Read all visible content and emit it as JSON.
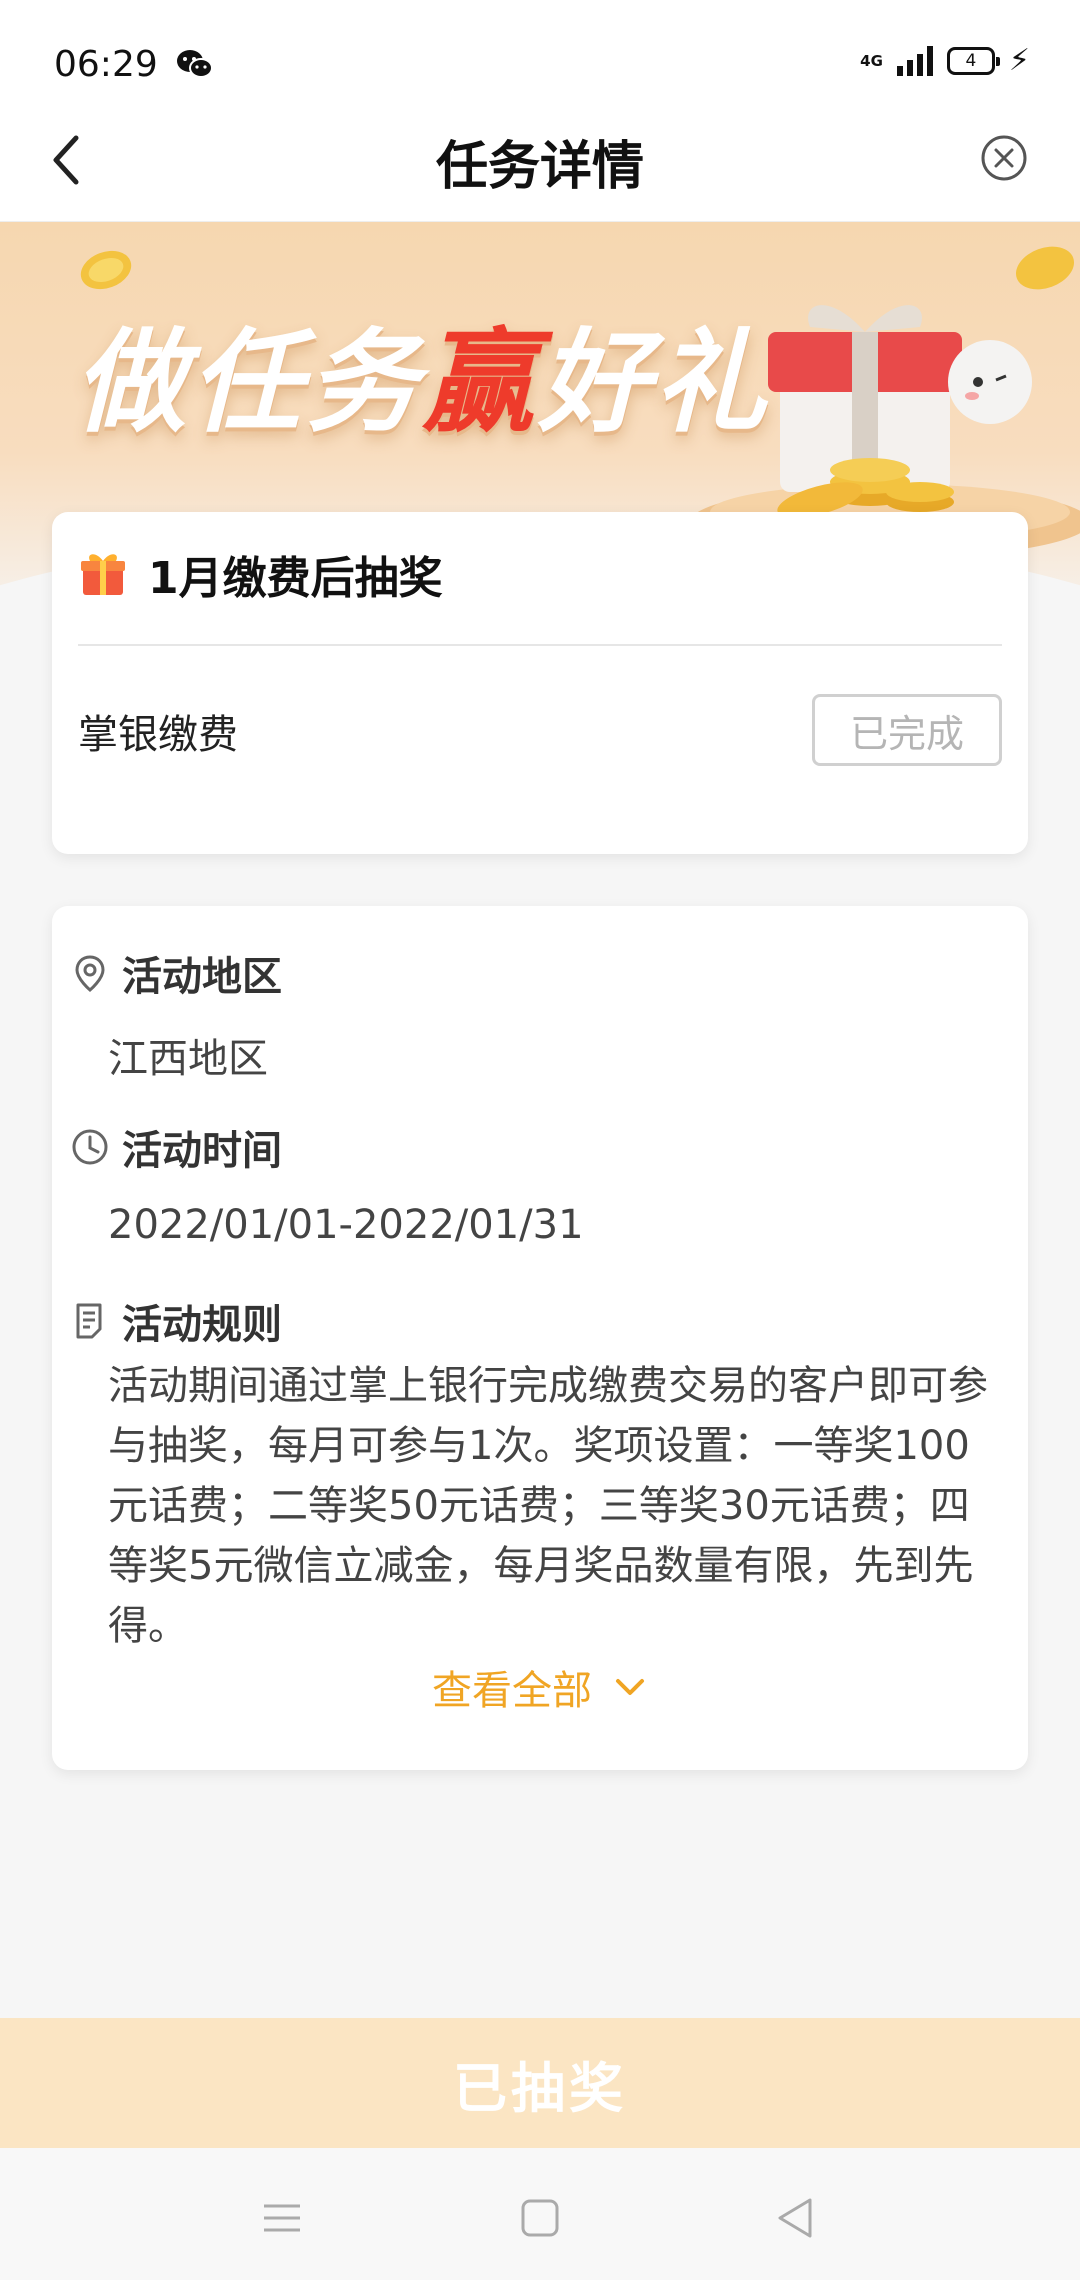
{
  "status_bar": {
    "time": "06:29",
    "network": "4G",
    "battery": "4"
  },
  "nav": {
    "title": "任务详情"
  },
  "banner": {
    "slogan_part1": "做任务",
    "slogan_highlight": "赢",
    "slogan_part2": "好礼"
  },
  "task_card": {
    "title": "1月缴费后抽奖",
    "item_label": "掌银缴费",
    "status_label": "已完成"
  },
  "info_card": {
    "region_title": "活动地区",
    "region_value": "江西地区",
    "time_title": "活动时间",
    "time_value": "2022/01/01-2022/01/31",
    "rules_title": "活动规则",
    "rules_text": "活动期间通过掌上银行完成缴费交易的客户即可参与抽奖，每月可参与1次。奖项设置：一等奖100元话费；二等奖50元话费；三等奖30元话费；四等奖5元微信立减金，每月奖品数量有限，先到先得。",
    "view_all_label": "查看全部"
  },
  "bottom_button": {
    "label": "已抽奖"
  },
  "colors": {
    "accent": "#f0a524",
    "highlight_red": "#ee3b2b",
    "banner_bg": "#f6d7b0",
    "disabled_button_bg": "#fbe5c3"
  },
  "icons": {
    "back": "chevron-left-icon",
    "close": "close-circle-icon",
    "gift": "gift-icon",
    "location": "location-pin-icon",
    "clock": "clock-icon",
    "rules": "document-icon",
    "chevron": "chevron-down-icon",
    "menu": "menu-icon",
    "home": "home-square-icon",
    "back_triangle": "back-triangle-icon"
  }
}
